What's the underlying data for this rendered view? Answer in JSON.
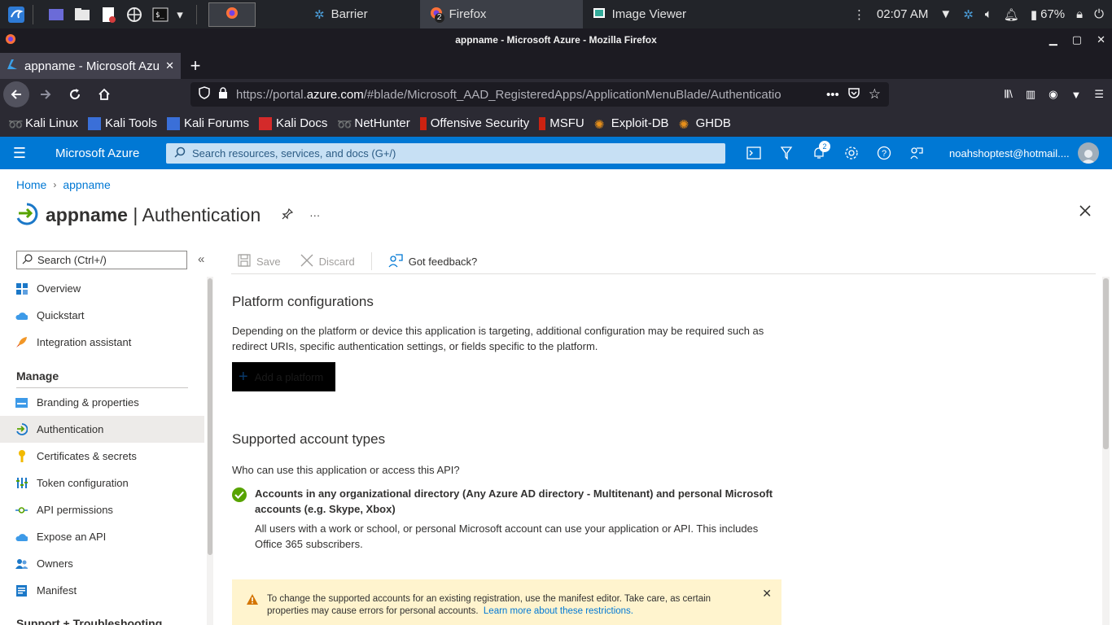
{
  "os_panel": {
    "tasks": [
      {
        "label": "Barrier",
        "icon": "barrier-icon"
      },
      {
        "label": "Firefox",
        "icon": "firefox-icon",
        "badge": "2"
      },
      {
        "label": "Image Viewer",
        "icon": "image-viewer-icon"
      }
    ],
    "clock": "02:07 AM",
    "battery": "67%"
  },
  "firefox": {
    "window_title": "appname - Microsoft Azure - Mozilla Firefox",
    "tab_title": "appname - Microsoft Azu",
    "url_prefix": "https://portal.",
    "url_domain": "azure.com",
    "url_rest": "/#blade/Microsoft_AAD_RegisteredApps/ApplicationMenuBlade/Authenticatio",
    "bookmarks": [
      "Kali Linux",
      "Kali Tools",
      "Kali Forums",
      "Kali Docs",
      "NetHunter",
      "Offensive Security",
      "MSFU",
      "Exploit-DB",
      "GHDB"
    ]
  },
  "azure_header": {
    "brand": "Microsoft Azure",
    "search_placeholder": "Search resources, services, and docs (G+/)",
    "notifications_count": "2",
    "user": "noahshoptest@hotmail...."
  },
  "breadcrumb": {
    "home": "Home",
    "app": "appname"
  },
  "page": {
    "app_name": "appname",
    "separator": " | ",
    "blade_title": "Authentication",
    "more": "···"
  },
  "menu": {
    "search_placeholder": "Search (Ctrl+/)",
    "items_top": [
      {
        "label": "Overview",
        "icon": "overview-icon"
      },
      {
        "label": "Quickstart",
        "icon": "quickstart-icon"
      },
      {
        "label": "Integration assistant",
        "icon": "rocket-icon"
      }
    ],
    "manage_label": "Manage",
    "items_manage": [
      {
        "label": "Branding & properties",
        "icon": "branding-icon"
      },
      {
        "label": "Authentication",
        "icon": "authentication-icon"
      },
      {
        "label": "Certificates & secrets",
        "icon": "key-icon"
      },
      {
        "label": "Token configuration",
        "icon": "token-icon"
      },
      {
        "label": "API permissions",
        "icon": "api-permissions-icon"
      },
      {
        "label": "Expose an API",
        "icon": "cloud-icon"
      },
      {
        "label": "Owners",
        "icon": "owners-icon"
      },
      {
        "label": "Manifest",
        "icon": "manifest-icon"
      }
    ],
    "support_label": "Support + Troubleshooting"
  },
  "cmdbar": {
    "save": "Save",
    "discard": "Discard",
    "feedback": "Got feedback?"
  },
  "content": {
    "platform_title": "Platform configurations",
    "platform_desc_1": "Depending on the platform or device this application is targeting, additional configuration may be required such as",
    "platform_desc_2": "redirect URIs, specific authentication settings, or fields specific to the platform.",
    "add_platform": "Add a platform",
    "accounts_title": "Supported account types",
    "accounts_question": "Who can use this application or access this API?",
    "accounts_option_1": "Accounts in any organizational directory (Any Azure AD directory - Multitenant) and personal Microsoft",
    "accounts_option_2": "accounts (e.g. Skype, Xbox)",
    "accounts_desc_1": "All users with a work or school, or personal Microsoft account can use your application or API. This includes",
    "accounts_desc_2": "Office 365 subscribers.",
    "warning_1": "To change the supported accounts for an existing registration, use the manifest editor. Take care, as certain",
    "warning_2": "properties may cause errors for personal accounts.",
    "warning_link": "Learn more about these restrictions."
  },
  "colors": {
    "azure_blue": "#0078d4",
    "success_green": "#57a300",
    "warning_bg": "#fff4ce"
  }
}
